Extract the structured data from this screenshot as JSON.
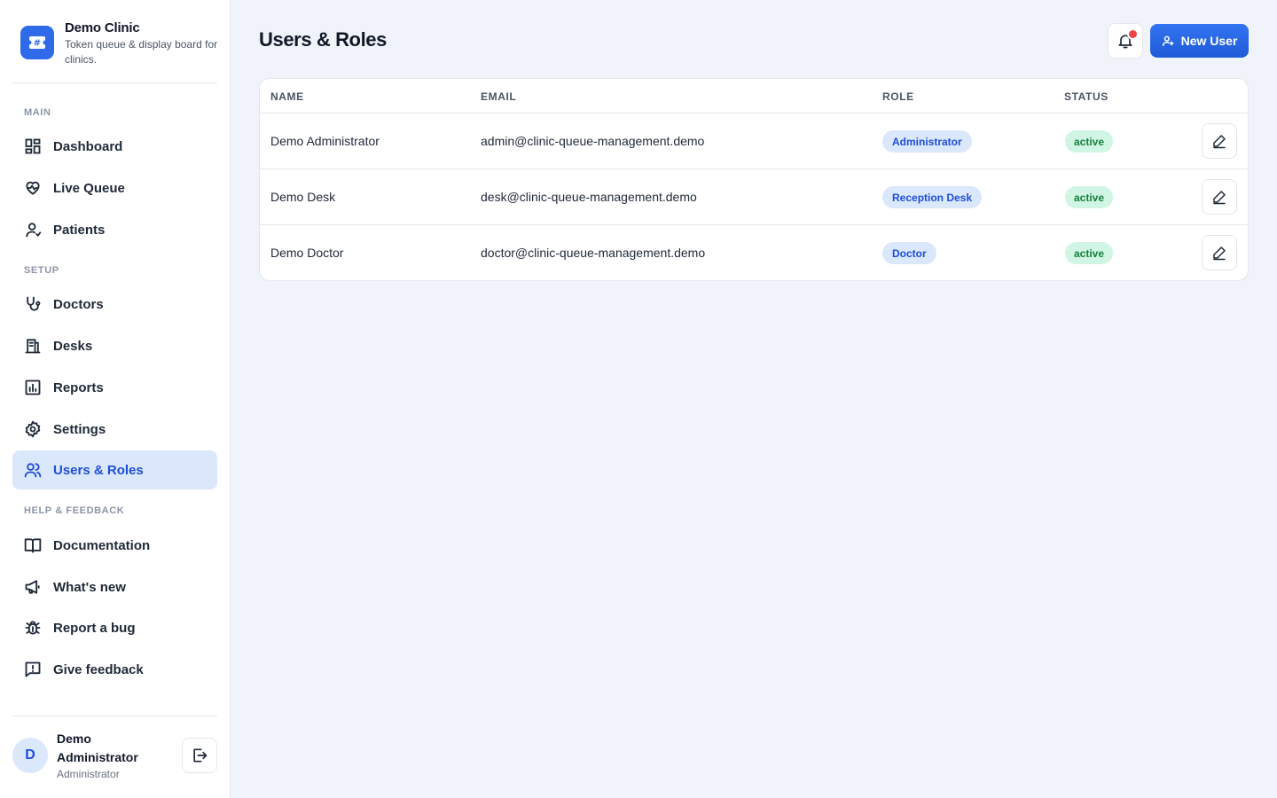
{
  "brand": {
    "name": "Demo Clinic",
    "tagline": "Token queue & display board for clinics.",
    "accent": "#2f6ae8"
  },
  "sidebar": {
    "sections": [
      {
        "title": "MAIN",
        "items": [
          {
            "label": "Dashboard",
            "icon": "dashboard-icon"
          },
          {
            "label": "Live Queue",
            "icon": "heart-pulse-icon"
          },
          {
            "label": "Patients",
            "icon": "user-icon"
          }
        ]
      },
      {
        "title": "SETUP",
        "items": [
          {
            "label": "Doctors",
            "icon": "stethoscope-icon"
          },
          {
            "label": "Desks",
            "icon": "desk-icon"
          },
          {
            "label": "Reports",
            "icon": "bar-chart-icon"
          },
          {
            "label": "Settings",
            "icon": "gear-icon"
          },
          {
            "label": "Users & Roles",
            "icon": "users-icon",
            "active": true
          }
        ]
      },
      {
        "title": "HELP & FEEDBACK",
        "items": [
          {
            "label": "Documentation",
            "icon": "book-icon"
          },
          {
            "label": "What's new",
            "icon": "megaphone-icon"
          },
          {
            "label": "Report a bug",
            "icon": "bug-icon"
          },
          {
            "label": "Give feedback",
            "icon": "feedback-icon"
          }
        ]
      }
    ]
  },
  "current_user": {
    "initial": "D",
    "name": "Demo Administrator",
    "role": "Administrator"
  },
  "header": {
    "title": "Users & Roles",
    "new_user_label": "New User"
  },
  "table": {
    "columns": [
      "NAME",
      "EMAIL",
      "ROLE",
      "STATUS"
    ],
    "rows": [
      {
        "name": "Demo Administrator",
        "email": "admin@clinic-queue-management.demo",
        "role": "Administrator",
        "status": "active"
      },
      {
        "name": "Demo Desk",
        "email": "desk@clinic-queue-management.demo",
        "role": "Reception Desk",
        "status": "active"
      },
      {
        "name": "Demo Doctor",
        "email": "doctor@clinic-queue-management.demo",
        "role": "Doctor",
        "status": "active"
      }
    ]
  },
  "colors": {
    "primary": "#2563eb",
    "active_nav_bg": "#dbe7fb",
    "status_active_bg": "#d1f5e4",
    "status_active_text": "#15803d",
    "notification_dot": "#ef4444"
  }
}
